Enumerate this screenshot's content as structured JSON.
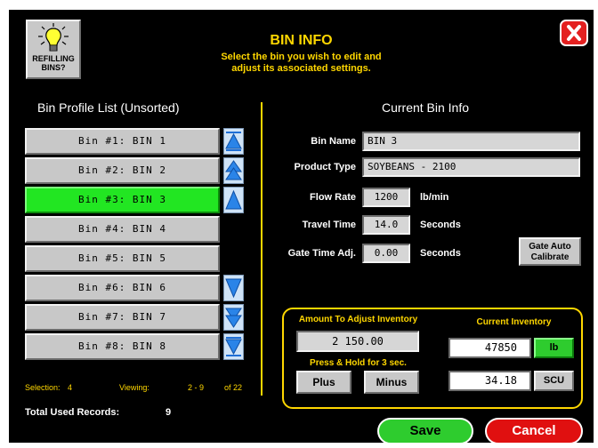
{
  "header": {
    "title": "BIN INFO",
    "subtitle_line1": "Select the bin you wish to edit and",
    "subtitle_line2": "adjust its associated settings.",
    "refill_line1": "REFILLING",
    "refill_line2": "BINS?"
  },
  "left": {
    "heading": "Bin Profile List (Unsorted)",
    "bins": [
      "Bin #1: BIN 1",
      "Bin #2: BIN 2",
      "Bin #3: BIN 3",
      "Bin #4: BIN 4",
      "Bin #5: BIN 5",
      "Bin #6: BIN 6",
      "Bin #7: BIN 7",
      "Bin #8: BIN 8"
    ],
    "selected_index": 2,
    "status": {
      "selection_label": "Selection:",
      "selection_value": "4",
      "viewing_label": "Viewing:",
      "viewing_range": "2 - 9",
      "viewing_total": "of 22",
      "total_label": "Total Used Records:",
      "total_value": "9"
    }
  },
  "right": {
    "heading": "Current Bin Info",
    "bin_name_label": "Bin Name",
    "bin_name_value": "BIN 3",
    "product_type_label": "Product Type",
    "product_type_value": "SOYBEANS - 2100",
    "flow_rate_label": "Flow Rate",
    "flow_rate_value": "1200",
    "flow_rate_unit": "lb/min",
    "travel_time_label": "Travel Time",
    "travel_time_value": "14.0",
    "travel_time_unit": "Seconds",
    "gate_time_label": "Gate Time Adj.",
    "gate_time_value": "0.00",
    "gate_time_unit": "Seconds",
    "gate_auto_line1": "Gate Auto",
    "gate_auto_line2": "Calibrate"
  },
  "inventory": {
    "adjust_label": "Amount To Adjust Inventory",
    "adjust_value": "2 150.00",
    "hold_note": "Press & Hold for 3 sec.",
    "plus_label": "Plus",
    "minus_label": "Minus",
    "current_label": "Current Inventory",
    "lb_value": "47850",
    "lb_unit": "lb",
    "scu_value": "34.18",
    "scu_unit": "SCU"
  },
  "footer": {
    "save_label": "Save",
    "cancel_label": "Cancel"
  },
  "colors": {
    "background": "#000000",
    "accent_yellow": "#ffd700",
    "selected_green": "#22e622",
    "save_green": "#2ecc2e",
    "cancel_red": "#e01010"
  },
  "icons": {
    "refill": "lightbulb-icon",
    "close": "close-icon",
    "scroll_top": "scroll-top-icon",
    "scroll_page_up": "page-up-icon",
    "scroll_up": "arrow-up-icon",
    "scroll_down": "arrow-down-icon",
    "scroll_page_down": "page-down-icon",
    "scroll_bottom": "scroll-bottom-icon"
  }
}
